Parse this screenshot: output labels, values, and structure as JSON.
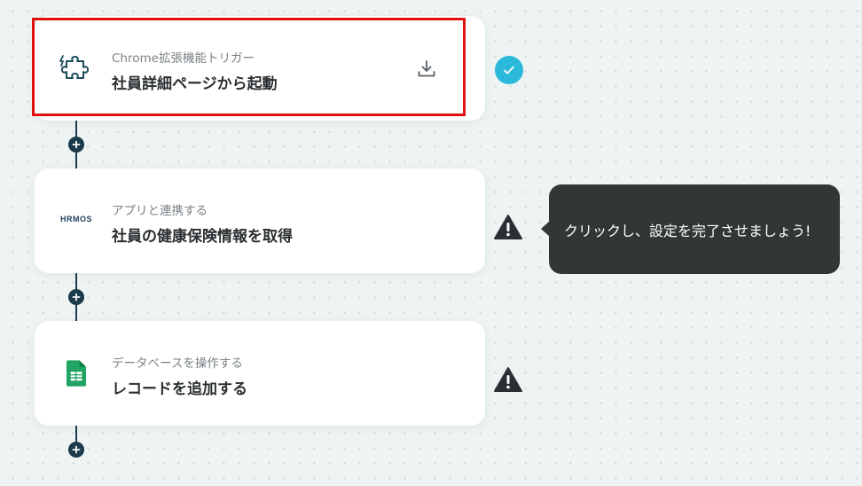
{
  "flow": {
    "steps": [
      {
        "category": "Chrome拡張機能トリガー",
        "title": "社員詳細ページから起動",
        "logo": "puzzle-icon",
        "action_icon": "download-icon",
        "status": "complete",
        "selected": true
      },
      {
        "category": "アプリと連携する",
        "title": "社員の健康保険情報を取得",
        "logo": "hrmos-logo",
        "logo_text": "HRMOS",
        "status": "warning"
      },
      {
        "category": "データベースを操作する",
        "title": "レコードを追加する",
        "logo": "google-sheets-icon",
        "status": "warning"
      }
    ],
    "tooltip": "クリックし、設定を完了させましょう!"
  },
  "colors": {
    "background": "#eef4f3",
    "connector": "#1b3a4b",
    "check": "#2ab9d9",
    "tooltip_bg": "#333637",
    "selection": "#e01010",
    "sheets_green": "#1fa463"
  }
}
